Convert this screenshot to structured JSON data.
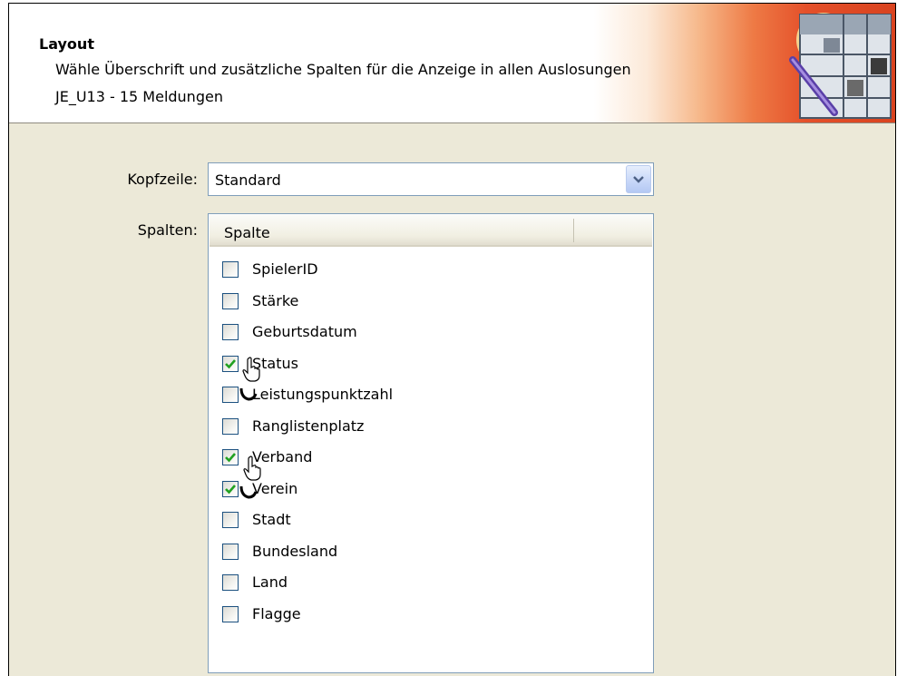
{
  "header": {
    "title": "Layout",
    "description": "Wähle Überschrift und zusätzliche Spalten für die Anzeige in allen Auslosungen",
    "subtitle": "JE_U13 - 15 Meldungen",
    "icon": "table-layout-wizard-icon"
  },
  "kopfzeile": {
    "label": "Kopfzeile:",
    "value": "Standard"
  },
  "spalten": {
    "label": "Spalten:",
    "column_header": "Spalte",
    "items": [
      {
        "label": "SpielerID",
        "checked": false
      },
      {
        "label": "Stärke",
        "checked": false
      },
      {
        "label": "Geburtsdatum",
        "checked": false
      },
      {
        "label": "Status",
        "checked": true
      },
      {
        "label": "Leistungspunktzahl",
        "checked": false
      },
      {
        "label": "Ranglistenplatz",
        "checked": false
      },
      {
        "label": "Verband",
        "checked": true
      },
      {
        "label": "Verein",
        "checked": true
      },
      {
        "label": "Stadt",
        "checked": false
      },
      {
        "label": "Bundesland",
        "checked": false
      },
      {
        "label": "Land",
        "checked": false
      },
      {
        "label": "Flagge",
        "checked": false
      }
    ]
  },
  "colors": {
    "dialog_bg": "#ece9d8",
    "border_blue": "#7f9db9",
    "check_green": "#21a121",
    "header_accent": "#d9431f"
  }
}
